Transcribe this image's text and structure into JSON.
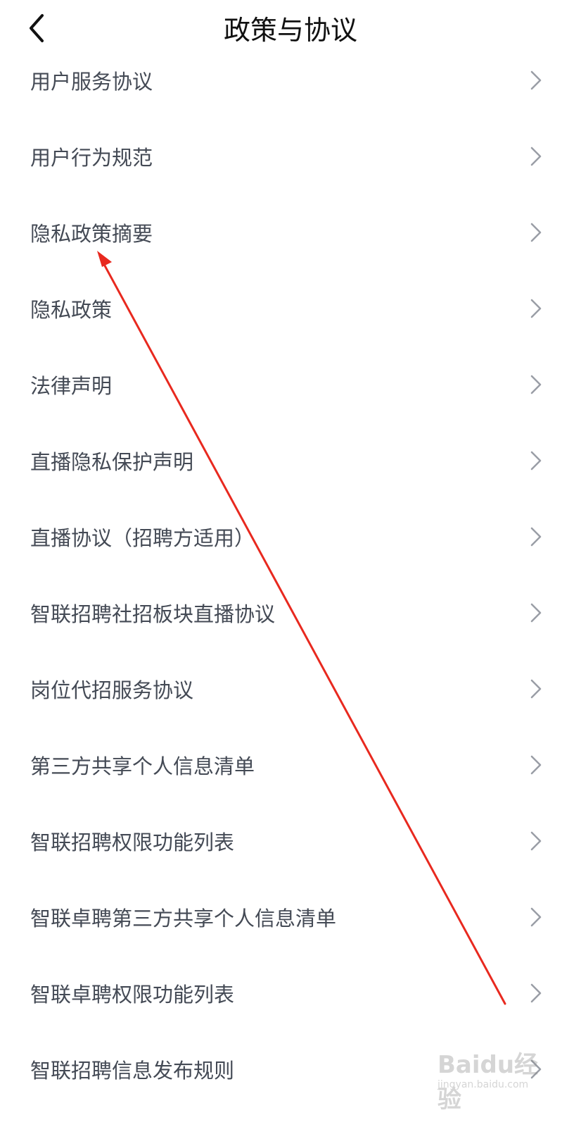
{
  "header": {
    "title": "政策与协议",
    "back_icon": "chevron-left-icon"
  },
  "list": {
    "chevron_icon": "chevron-right-icon",
    "items": [
      {
        "label": "用户服务协议"
      },
      {
        "label": "用户行为规范"
      },
      {
        "label": "隐私政策摘要"
      },
      {
        "label": "隐私政策"
      },
      {
        "label": "法律声明"
      },
      {
        "label": "直播隐私保护声明"
      },
      {
        "label": "直播协议（招聘方适用）"
      },
      {
        "label": "智联招聘社招板块直播协议"
      },
      {
        "label": "岗位代招服务协议"
      },
      {
        "label": "第三方共享个人信息清单"
      },
      {
        "label": "智联招聘权限功能列表"
      },
      {
        "label": "智联卓聘第三方共享个人信息清单"
      },
      {
        "label": "智联卓聘权限功能列表"
      },
      {
        "label": "智联招聘信息发布规则"
      }
    ]
  },
  "annotation": {
    "color": "#e8291f"
  },
  "watermark": {
    "main": "Baidu经验",
    "sub": "jingyan.baidu.com"
  }
}
